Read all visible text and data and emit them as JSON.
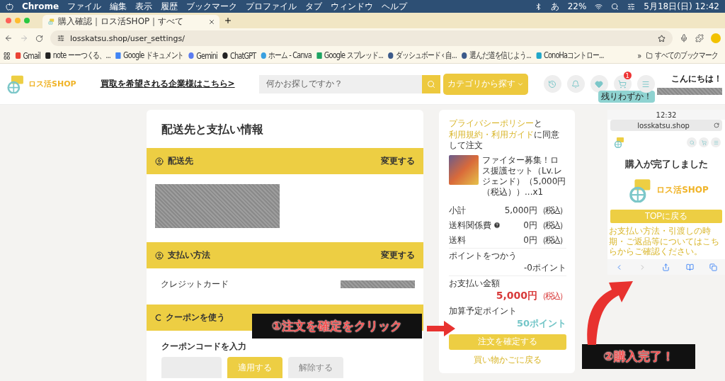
{
  "menubar": {
    "app": "Chrome",
    "items": [
      "ファイル",
      "編集",
      "表示",
      "履歴",
      "ブックマーク",
      "プロファイル",
      "タブ",
      "ウィンドウ",
      "ヘルプ"
    ],
    "input_mode": "あ",
    "battery": "22%",
    "clock": "5月18日(日)  12:42"
  },
  "browser": {
    "tabs": [
      {
        "title": "購入確認｜ロス活SHOP｜すべて",
        "selected": true
      }
    ],
    "url": "losskatsu.shop/user_settings/",
    "bookmarks": [
      {
        "kind": "gmail",
        "label": "Gmail"
      },
      {
        "kind": "note",
        "label": "note ーーつくる、..."
      },
      {
        "kind": "docs",
        "label": "Google ドキュメント"
      },
      {
        "kind": "gemini",
        "label": "Gemini"
      },
      {
        "kind": "chatgpt",
        "label": "ChatGPT"
      },
      {
        "kind": "canva",
        "label": "ホーム - Canva"
      },
      {
        "kind": "sheets",
        "label": "Google スプレッド..."
      },
      {
        "kind": "wordpress",
        "label": "ダッシュボード ‹ 自..."
      },
      {
        "kind": "wordpress",
        "label": "選んだ道を信じよう..."
      },
      {
        "kind": "conoha",
        "label": "ConoHaコントロー..."
      }
    ],
    "more": "»",
    "all_bookmarks": "すべてのブックマーク"
  },
  "site_header": {
    "logo": "ロス活SHOP",
    "business_link": "買取を希望される企業様はこちら>",
    "search": {
      "placeholder": "何かお探しですか？"
    },
    "category_button": "カテゴリから探す",
    "cart_badge": "1",
    "greeting": "こんにちは！",
    "tooltip": "残りわずか！"
  },
  "checkout": {
    "title": "配送先と支払い情報",
    "sections": [
      {
        "kind": "address",
        "heading": "配送先",
        "action": "変更する"
      },
      {
        "kind": "payment",
        "heading": "支払い方法",
        "action": "変更する",
        "method": "クレジットカード"
      },
      {
        "kind": "coupon",
        "heading": "クーポンを使う",
        "field_label": "クーポンコードを入力",
        "apply": "適用する",
        "remove": "解除する"
      }
    ]
  },
  "summary": {
    "agreement": [
      {
        "kind": "link",
        "text": "プライバシーポリシー"
      },
      {
        "kind": "plain",
        "text": "と"
      },
      {
        "kind": "link",
        "text": "利用規約・利用ガイド"
      },
      {
        "kind": "plain",
        "text": "に同意して注文"
      }
    ],
    "product": {
      "name": "ファイター募集！ロス援護セット（Lv.レジェンド）（5,000円（税込））...x1"
    },
    "rows": [
      {
        "kind": "plain",
        "label": "小計",
        "value": "5,000円",
        "tax": "（税込）"
      },
      {
        "kind": "help",
        "label": "送料関係費",
        "value": "0円",
        "tax": "（税込）"
      },
      {
        "kind": "plain",
        "label": "送料",
        "value": "0円",
        "tax": "（税込）"
      },
      {
        "kind": "points",
        "label": "ポイントをつかう",
        "value": "-0ポイント"
      },
      {
        "kind": "total",
        "label": "お支払い金額",
        "value": "5,000円",
        "tax": "（税込）"
      },
      {
        "kind": "earn",
        "label": "加算予定ポイント",
        "value": "50ポイント"
      }
    ],
    "confirm_button": "注文を確定する",
    "back_link": "買い物かごに戻る"
  },
  "phone": {
    "time": "12:32",
    "url": "losskatsu.shop",
    "heading": "購入が完了しました",
    "logo": "ロス活SHOP",
    "top_button": "TOPに戻る",
    "notice": "お支払い方法・引渡しの時期・ご返品等についてはこちらからご確認ください。"
  },
  "annotations": [
    {
      "kind": "click",
      "text": "①注文を確定をクリック"
    },
    {
      "kind": "done",
      "text": "②購入完了！"
    }
  ]
}
